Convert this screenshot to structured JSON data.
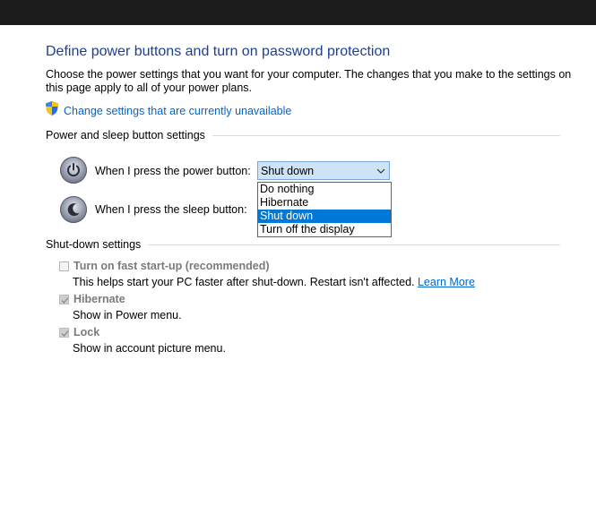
{
  "page": {
    "title": "Define power buttons and turn on password protection",
    "description": "Choose the power settings that you want for your computer. The changes that you make to the settings on this page apply to all of your power plans.",
    "uac_link": "Change settings that are currently unavailable"
  },
  "power_section": {
    "title": "Power and sleep button settings",
    "power_button_label": "When I press the power button:",
    "sleep_button_label": "When I press the sleep button:",
    "power_button_value": "Shut down",
    "dropdown_options": [
      "Do nothing",
      "Hibernate",
      "Shut down",
      "Turn off the display"
    ],
    "selected_index": 2
  },
  "shutdown_section": {
    "title": "Shut-down settings",
    "fast_startup": {
      "label": "Turn on fast start-up (recommended)",
      "description": "This helps start your PC faster after shut-down. Restart isn't affected.",
      "link": "Learn More",
      "checked": false
    },
    "hibernate": {
      "label": "Hibernate",
      "description": "Show in Power menu.",
      "checked": true
    },
    "lock": {
      "label": "Lock",
      "description": "Show in account picture menu.",
      "checked": true
    }
  },
  "icons": {
    "uac": "uac-shield-icon",
    "power": "power-button-icon",
    "sleep": "sleep-moon-icon",
    "dropdown": "chevron-down-icon",
    "check": "check-icon"
  },
  "colors": {
    "title": "#1c3f95",
    "link": "#0066cc",
    "selection": "#0078d7",
    "topbar": "#1b1b1b"
  }
}
